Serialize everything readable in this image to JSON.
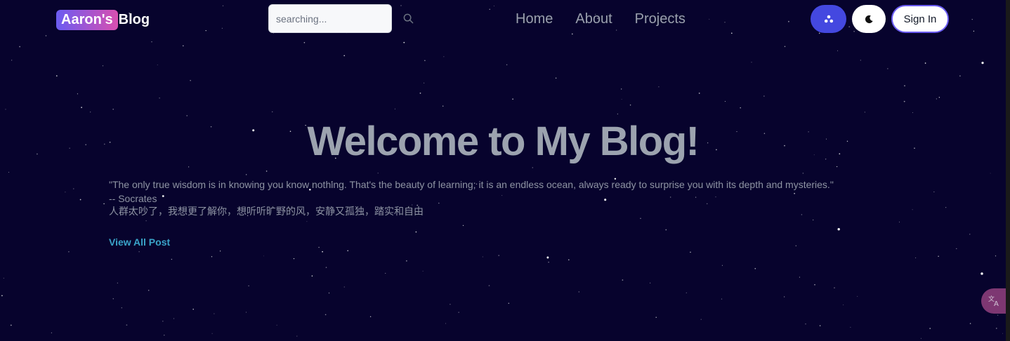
{
  "header": {
    "logo_badge": "Aaron's",
    "logo_rest": "Blog",
    "search_placeholder": "searching...",
    "nav": [
      {
        "label": "Home"
      },
      {
        "label": "About"
      },
      {
        "label": "Projects"
      }
    ],
    "theme_icon": "triangle-dots-icon",
    "dark_mode_icon": "moon-icon",
    "sign_in_label": "Sign In"
  },
  "hero": {
    "title": "Welcome to My Blog!",
    "quote_line1": "\"The only true wisdom is in knowing you know nothing. That's the beauty of learning; it is an endless ocean, always ready to surprise you with its depth and mysteries.\"",
    "quote_line2": "-- Socrates",
    "quote_line3": "人群太吵了，我想更了解你，想听听旷野的风，安静又孤独，踏实和自由",
    "view_all_label": "View All Post"
  },
  "floating": {
    "translate_icon": "translate-icon"
  },
  "colors": {
    "background": "#07032d",
    "accent_blue": "#4448e0",
    "link": "#3aa4c9",
    "gradient_start": "#6b5cf2",
    "gradient_end": "#d84fb0"
  }
}
